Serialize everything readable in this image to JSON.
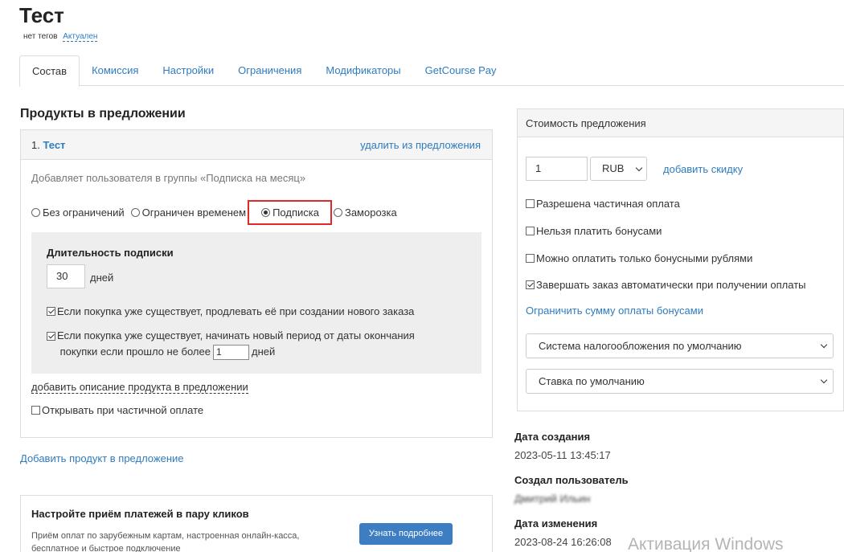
{
  "page": {
    "title": "Тест",
    "tags": "нет тегов",
    "status": "Актуален"
  },
  "tabs": [
    "Состав",
    "Комиссия",
    "Настройки",
    "Ограничения",
    "Модификаторы",
    "GetCourse Pay"
  ],
  "products": {
    "section_title": "Продукты в предложении",
    "item": {
      "number": "1.",
      "name": "Тест",
      "remove_label": "удалить из предложения",
      "description": "Добавляет пользователя в группы «Подписка на месяц»",
      "radios": [
        {
          "label": "Без ограничений",
          "selected": false
        },
        {
          "label": "Ограничен временем",
          "selected": false
        },
        {
          "label": "Подписка",
          "selected": true
        },
        {
          "label": "Заморозка",
          "selected": false
        }
      ],
      "subscription": {
        "title": "Длительность подписки",
        "duration_value": "30",
        "duration_unit": "дней",
        "extend_check": "Если покупка уже существует, продлевать её при создании нового заказа",
        "extend_checked": true,
        "newperiod_check_part1": "Если покупка уже существует, начинать новый период от даты окончания",
        "newperiod_check_part2": "покупки если прошло не более",
        "newperiod_value": "1",
        "newperiod_unit": "дней",
        "newperiod_checked": true
      },
      "add_description": "добавить описание продукта в предложении",
      "open_partial": "Открывать при частичной оплате",
      "open_partial_checked": false
    },
    "add_product": "Добавить продукт в предложение"
  },
  "promo": {
    "title": "Настройте приём платежей в пару кликов",
    "text": "Приём оплат по зарубежным картам, настроенная онлайн-касса, бесплатное и быстрое подключение",
    "button": "Узнать подробнее"
  },
  "price": {
    "title": "Стоимость предложения",
    "amount": "1",
    "currency": "RUB",
    "add_discount": "добавить скидку",
    "checks": [
      {
        "label": "Разрешена частичная оплата",
        "checked": false
      },
      {
        "label": "Нельзя платить бонусами",
        "checked": false
      },
      {
        "label": "Можно оплатить только бонусными рублями",
        "checked": false
      },
      {
        "label": "Завершать заказ автоматически при получении оплаты",
        "checked": true
      }
    ],
    "limit_bonus": "Ограничить сумму оплаты бонусами",
    "tax_system": "Система налогообложения по умолчанию",
    "tax_rate": "Ставка по умолчанию"
  },
  "info": {
    "created_label": "Дата создания",
    "created_value": "2023-05-11 13:45:17",
    "creator_label": "Создал пользователь",
    "creator_value": "Дмитрий Ильин",
    "modified_label": "Дата изменения",
    "modified_value": "2023-08-24 16:26:08"
  },
  "watermark": "Активация Windows"
}
